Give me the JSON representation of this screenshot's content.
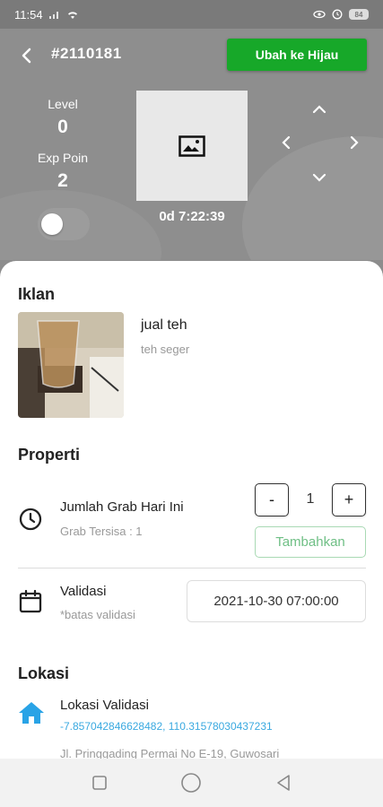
{
  "status_bar": {
    "time": "11:54",
    "battery": "84"
  },
  "header": {
    "order_id": "#2110181",
    "action_button": "Ubah ke Hijau",
    "level_label": "Level",
    "level_value": "0",
    "exp_label": "Exp Poin",
    "exp_value": "2",
    "timer": "0d 7:22:39"
  },
  "iklan": {
    "title": "Iklan",
    "ad_title": "jual teh",
    "ad_desc": "teh seger"
  },
  "properti": {
    "title": "Properti",
    "grab_title": "Jumlah Grab Hari Ini",
    "grab_sub": "Grab Tersisa : 1",
    "minus_label": "-",
    "plus_label": "+",
    "quantity": "1",
    "add_button": "Tambahkan",
    "validasi_title": "Validasi",
    "validasi_sub": "*batas validasi",
    "validasi_date": "2021-10-30 07:00:00"
  },
  "lokasi": {
    "title": "Lokasi",
    "row_title": "Lokasi Validasi",
    "coords": "-7.85704284662848​2, 110.31578030437231",
    "address": "Jl. Pringgading Permai No E-19, Guwosari"
  },
  "colors": {
    "accent_green": "#17a829",
    "link_blue": "#3aa9e0",
    "home_icon_blue": "#29a3e6"
  }
}
